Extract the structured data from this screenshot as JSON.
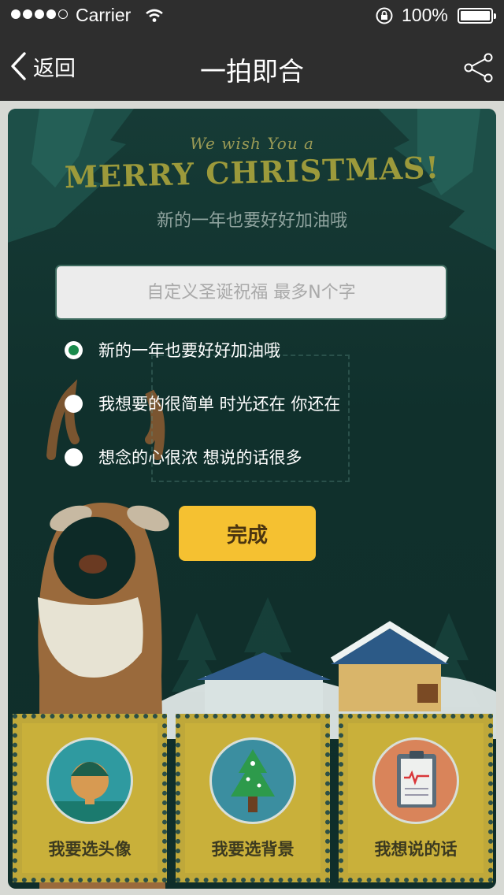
{
  "status_bar": {
    "carrier": "Carrier",
    "battery_percent": "100%"
  },
  "nav": {
    "back_label": "返回",
    "title": "一拍即合"
  },
  "card": {
    "wish_line": "We wish You a",
    "merry": "MERRY CHRISTMAS!",
    "subtitle": "新的一年也要好好加油哦",
    "input_placeholder": "自定义圣诞祝福 最多N个字",
    "options": [
      {
        "label": "新的一年也要好好加油哦",
        "selected": true
      },
      {
        "label": "我想要的很简单 时光还在 你还在",
        "selected": false
      },
      {
        "label": "想念的心很浓 想说的话很多",
        "selected": false
      }
    ],
    "done_label": "完成"
  },
  "stamps": [
    {
      "label": "我要选头像",
      "icon": "person-avatar-icon"
    },
    {
      "label": "我要选背景",
      "icon": "christmas-tree-icon"
    },
    {
      "label": "我想说的话",
      "icon": "clipboard-icon"
    }
  ],
  "colors": {
    "accent": "#f5c131",
    "radio_selected": "#1a8a4c",
    "card_bg": "#133632",
    "nav_bg": "#2e2e2e"
  }
}
